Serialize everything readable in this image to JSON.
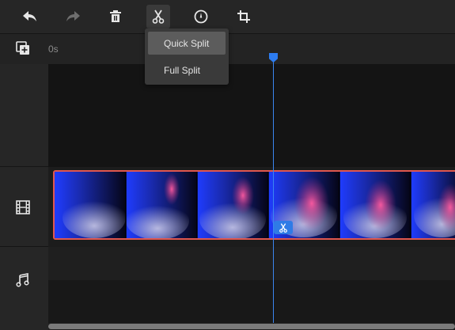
{
  "toolbar": {
    "buttons": [
      {
        "name": "undo-icon"
      },
      {
        "name": "redo-icon"
      },
      {
        "name": "delete-icon"
      },
      {
        "name": "scissors-icon"
      },
      {
        "name": "speed-icon"
      },
      {
        "name": "crop-icon"
      }
    ]
  },
  "split_menu": {
    "items": [
      {
        "label": "Quick Split"
      },
      {
        "label": "Full Split"
      }
    ]
  },
  "ruler": {
    "start_label": "0s"
  },
  "tracks": [
    {
      "icon": "film-icon"
    },
    {
      "icon": "music-note-icon"
    }
  ],
  "colors": {
    "accent": "#2d7cf0",
    "clip_border": "#e0574f"
  }
}
